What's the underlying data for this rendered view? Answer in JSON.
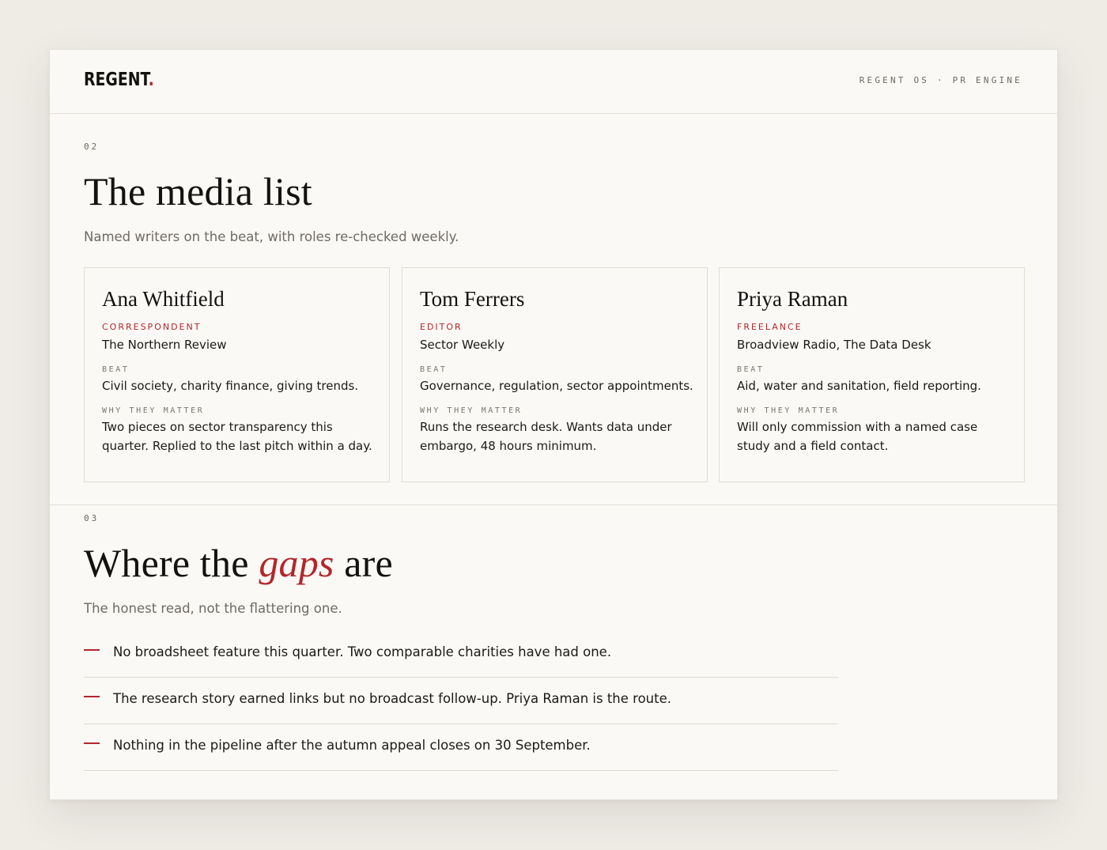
{
  "brand": {
    "logo": "REGENT",
    "logo_dot": ".",
    "system_label": "REGENT OS · PR ENGINE"
  },
  "media_list": {
    "number": "02",
    "title": "The media list",
    "subtitle": "Named writers on the beat, with roles re-checked weekly.",
    "beat_label": "BEAT",
    "why_label": "WHY THEY MATTER",
    "writers": [
      {
        "name": "Ana Whitfield",
        "role": "CORRESPONDENT",
        "outlet": "The Northern Review",
        "beat": "Civil society, charity finance, giving trends.",
        "why": "Two pieces on sector transparency this quarter. Replied to the last pitch within a day."
      },
      {
        "name": "Tom Ferrers",
        "role": "EDITOR",
        "outlet": "Sector Weekly",
        "beat": "Governance, regulation, sector appointments.",
        "why": "Runs the research desk. Wants data under embargo, 48 hours minimum."
      },
      {
        "name": "Priya Raman",
        "role": "FREELANCE",
        "outlet": "Broadview Radio, The Data Desk",
        "beat": "Aid, water and sanitation, field reporting.",
        "why": "Will only commission with a named case study and a field contact."
      }
    ]
  },
  "gaps_section": {
    "number": "03",
    "title_before": "Where the ",
    "title_highlight": "gaps",
    "title_after": " are",
    "subtitle": "The honest read, not the flattering one.",
    "items": [
      "No broadsheet feature this quarter. Two comparable charities have had one.",
      "The research story earned links but no broadcast follow-up. Priya Raman is the route.",
      "Nothing in the pipeline after the autumn appeal closes on 30 September."
    ]
  },
  "colors": {
    "accent": "#b3262a",
    "background": "#efece6",
    "card": "#faf9f6"
  }
}
